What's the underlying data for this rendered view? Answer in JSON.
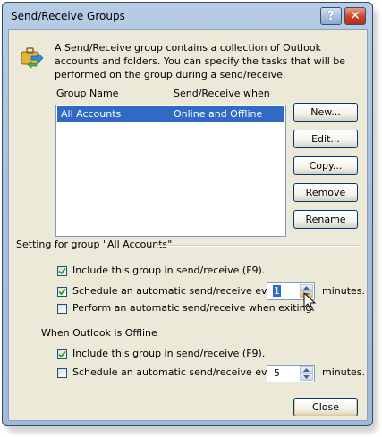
{
  "window": {
    "title": "Send/Receive Groups",
    "help_label": "?",
    "close_glyph": "✕"
  },
  "intro_text": "A Send/Receive group contains a collection of Outlook accounts and folders. You can specify the tasks that will be performed on the group during a send/receive.",
  "list": {
    "headers": [
      "Group Name",
      "Send/Receive when"
    ],
    "rows": [
      {
        "name": "All Accounts",
        "when": "Online and Offline",
        "selected": true
      }
    ]
  },
  "buttons": {
    "new": "New...",
    "edit": "Edit...",
    "copy": "Copy...",
    "remove": "Remove",
    "rename": "Rename",
    "close": "Close"
  },
  "setting_group": {
    "label": "Setting for group \"All Accounts\"",
    "include": {
      "label": "Include this group in send/receive (F9).",
      "checked": true
    },
    "schedule": {
      "label": "Schedule an automatic send/receive every",
      "checked": true,
      "value": "1",
      "unit": "minutes."
    },
    "exiting": {
      "label": "Perform an automatic send/receive when exiting.",
      "checked": false
    }
  },
  "offline_group": {
    "label": "When Outlook is Offline",
    "include": {
      "label": "Include this group in send/receive (F9).",
      "checked": true
    },
    "schedule": {
      "label": "Schedule an automatic send/receive every",
      "checked": false,
      "value": "5",
      "unit": "minutes."
    }
  },
  "colors": {
    "selection": "#316ac5",
    "dialog_bg": "#ece9d8",
    "frame": "#a9c1de"
  }
}
